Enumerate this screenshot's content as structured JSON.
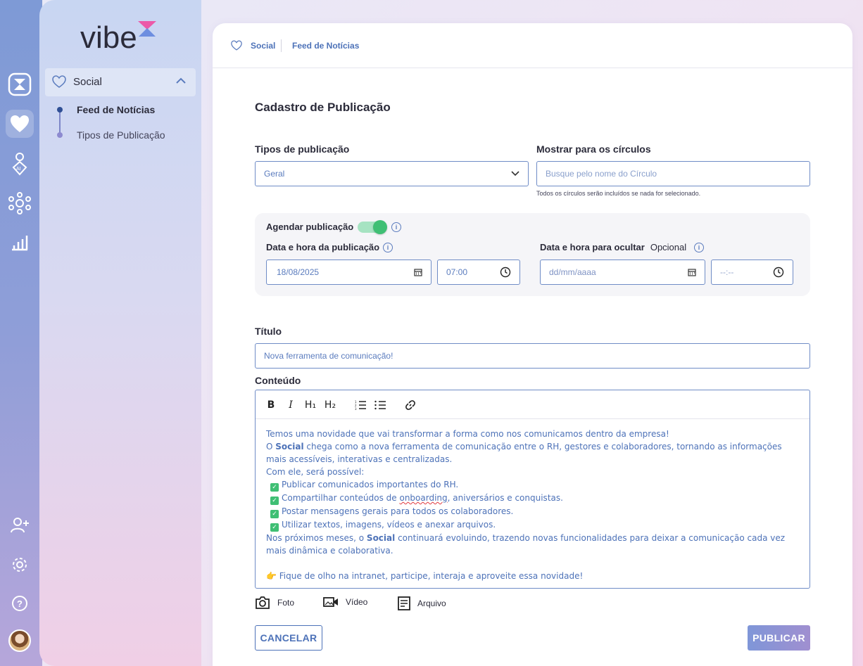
{
  "app": {
    "logo_text": "vibe"
  },
  "sidebar": {
    "group_label": "Social",
    "items": [
      {
        "label": "Feed de Notícias",
        "active": true
      },
      {
        "label": "Tipos de Publicação",
        "active": false
      }
    ]
  },
  "rail": {
    "icons": [
      "hourglass-icon",
      "heart-icon",
      "ai-person-icon",
      "network-icon",
      "bar-chart-icon",
      "add-user-icon",
      "gear-icon",
      "help-icon"
    ]
  },
  "breadcrumb": {
    "first": "Social",
    "second": "Feed de Notícias"
  },
  "form": {
    "title": "Cadastro de Publicação",
    "type_label": "Tipos de publicação",
    "type_value": "Geral",
    "circles_label": "Mostrar para os círculos",
    "circles_placeholder": "Busque pelo nome do Círculo",
    "circles_hint": "Todos os círculos serão incluídos se nada for selecionado.",
    "schedule_label": "Agendar publicação",
    "schedule_enabled": true,
    "publish_dt_label": "Data e hora da publicação",
    "publish_date": "18/08/2025",
    "publish_time": "07:00",
    "hide_dt_label": "Data e hora para ocultar",
    "hide_optional": "Opcional",
    "hide_date_placeholder": "dd/mm/aaaa",
    "hide_time_placeholder": "--:--",
    "title_label": "Título",
    "title_value": "Nova ferramenta de comunicação!",
    "content_label": "Conteúdo",
    "toolbar": {
      "bold": "B",
      "italic": "I",
      "h1": "H₁",
      "h2": "H₂"
    },
    "content": {
      "line1": "Temos uma novidade que vai transformar a forma como nos comunicamos dentro da empresa!",
      "line2_pre": "O ",
      "line2_bold": "Social",
      "line2_post": " chega como a nova ferramenta de comunicação entre o RH, gestores e colaboradores, tornando as informações mais acessíveis, interativas e centralizadas.",
      "line3": "Com ele, será possível:",
      "check1": "Publicar comunicados importantes do RH.",
      "check2_pre": "Compartilhar conteúdos de ",
      "check2_word": "onboarding",
      "check2_post": ", aniversários e conquistas.",
      "check3": "Postar mensagens gerais para todos os colaboradores.",
      "check4": "Utilizar textos, imagens, vídeos e anexar arquivos.",
      "line5_pre": "Nos próximos meses, o ",
      "line5_bold": "Social",
      "line5_post": " continuará evoluindo, trazendo novas funcionalidades para deixar a comunicação cada vez mais dinâmica e colaborativa.",
      "line6": "👉 Fique de olho na intranet, participe, interaja e aproveite essa novidade!"
    },
    "attachments": {
      "photo": "Foto",
      "video": "Vídeo",
      "file": "Arquivo"
    },
    "cancel_label": "CANCELAR",
    "publish_label": "PUBLICAR"
  },
  "colors": {
    "accent": "#4d72b8",
    "toggle_on": "#3fbf74",
    "brand_pink": "#ec5aa8"
  }
}
